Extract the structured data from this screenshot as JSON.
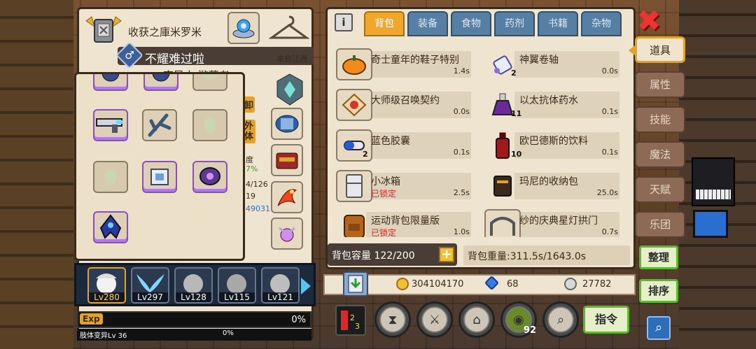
{
  "guild": {
    "name": "收获之庫米罗米"
  },
  "player": {
    "name": "不耀难过啦",
    "gender_symbol": "♂",
    "origin": "来自江西",
    "title": "变异人 游荡者"
  },
  "left_partial": {
    "label_a": "卸",
    "label_b": "外体",
    "text_1": "度",
    "text_2": "7%",
    "text_3": "4/126",
    "text_4": "19",
    "text_5": "49031"
  },
  "characters": [
    {
      "level": "Lv280",
      "active": true
    },
    {
      "level": "Lv297",
      "active": false
    },
    {
      "level": "Lv128",
      "active": false
    },
    {
      "level": "Lv115",
      "active": false
    },
    {
      "level": "Lv121",
      "active": false
    }
  ],
  "exp": {
    "tag": "Exp",
    "percent": "0%",
    "skill_label": "肢体变异Lv 36",
    "skill_percent": "0%"
  },
  "tabs": [
    {
      "label": "背包",
      "active": true
    },
    {
      "label": "装备",
      "active": false
    },
    {
      "label": "食物",
      "active": false
    },
    {
      "label": "药剂",
      "active": false
    },
    {
      "label": "书籍",
      "active": false
    },
    {
      "label": "杂物",
      "active": false
    }
  ],
  "items": [
    {
      "name": "奇士童年的鞋子特别",
      "time": "1.4s",
      "count": "",
      "locked": ""
    },
    {
      "name": "神翼卷轴",
      "time": "0.0s",
      "count": "2",
      "locked": ""
    },
    {
      "name": "大师级召唤契约",
      "time": "0.0s",
      "count": "",
      "locked": ""
    },
    {
      "name": "以太抗体药水",
      "time": "0.1s",
      "count": "11",
      "locked": ""
    },
    {
      "name": "蓝色胶囊",
      "time": "0.1s",
      "count": "2",
      "locked": ""
    },
    {
      "name": "欧巴德斯的饮料",
      "time": "0.1s",
      "count": "10",
      "locked": ""
    },
    {
      "name": "小冰箱",
      "time": "2.5s",
      "count": "",
      "locked": "已锁定"
    },
    {
      "name": "玛尼的收纳包",
      "time": "25.0s",
      "count": "",
      "locked": ""
    },
    {
      "name": "运动背包限量版",
      "time": "1.0s",
      "count": "",
      "locked": "已锁定"
    },
    {
      "name": "纱的庆典星灯拱门",
      "time": "0.7s",
      "count": "",
      "locked": ""
    }
  ],
  "bag": {
    "capacity_label": "背包容量 122/200",
    "plus": "+",
    "weight_label": "背包重量:311.5s/1643.0s"
  },
  "currency": {
    "gold": "304104170",
    "diamond": "68",
    "silver": "27782"
  },
  "side_tabs": [
    {
      "label": "道具",
      "active": true
    },
    {
      "label": "属性",
      "active": false
    },
    {
      "label": "技能",
      "active": false
    },
    {
      "label": "魔法",
      "active": false
    },
    {
      "label": "天赋",
      "active": false
    },
    {
      "label": "乐团",
      "active": false
    }
  ],
  "buttons": {
    "organize": "整理",
    "sort": "排序",
    "command": "指令",
    "close": "✖",
    "info": "i"
  },
  "action_counts": {
    "bag_count": "92"
  },
  "colors": {
    "active_tab": "#f0a82c",
    "inactive_tab": "#577fa3",
    "locked_text": "#d42b2b",
    "accent_green": "#5cb82f"
  }
}
